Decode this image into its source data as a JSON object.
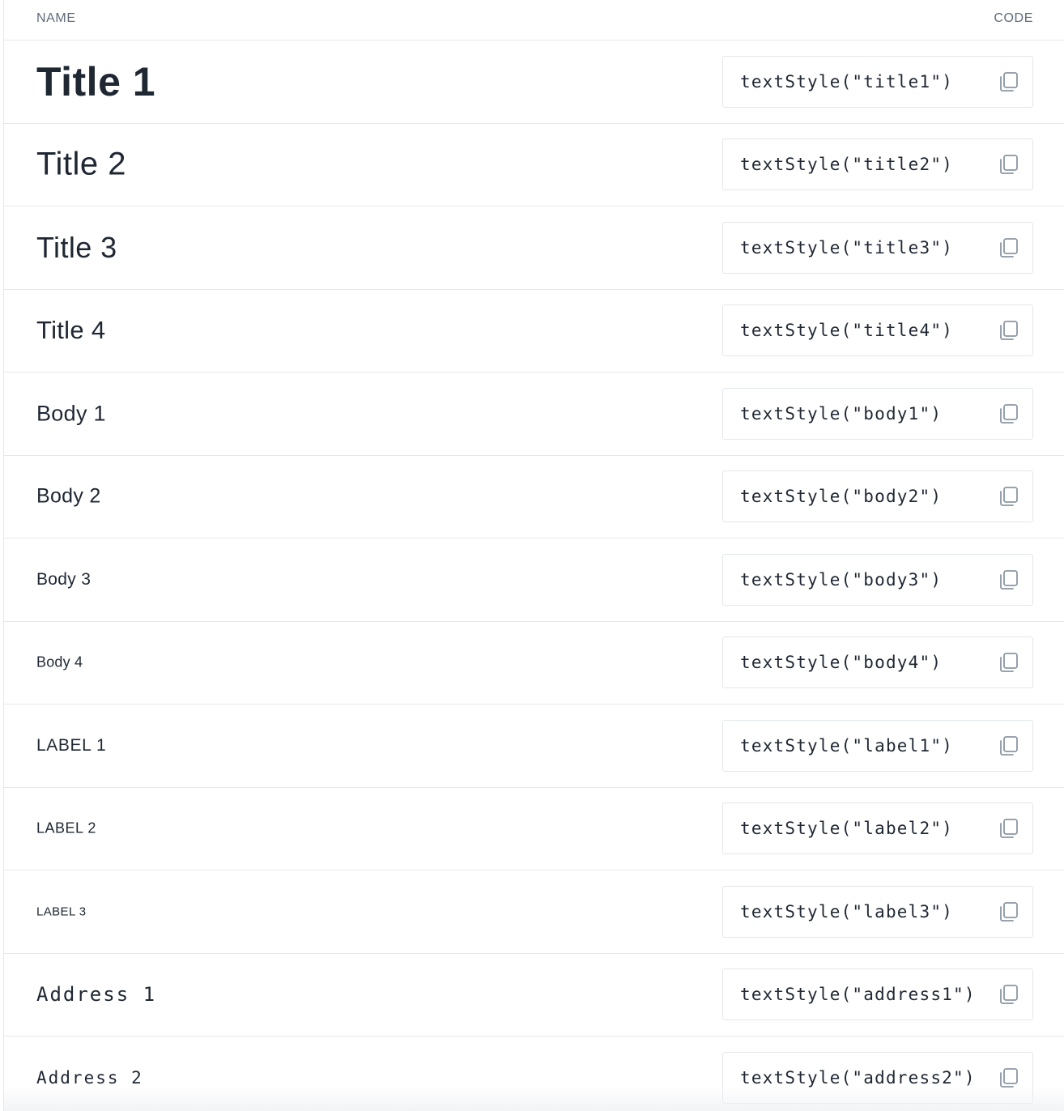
{
  "header": {
    "name_label": "NAME",
    "code_label": "CODE"
  },
  "icons": {
    "copy": "copy-icon"
  },
  "colors": {
    "text": "#1f2733",
    "muted": "#5f6b7a",
    "border": "#e6e8eb",
    "icon": "#8a96a3"
  },
  "rows": [
    {
      "name": "Title 1",
      "code": "textStyle(\"title1\")"
    },
    {
      "name": "Title 2",
      "code": "textStyle(\"title2\")"
    },
    {
      "name": "Title 3",
      "code": "textStyle(\"title3\")"
    },
    {
      "name": "Title 4",
      "code": "textStyle(\"title4\")"
    },
    {
      "name": "Body 1",
      "code": "textStyle(\"body1\")"
    },
    {
      "name": "Body 2",
      "code": "textStyle(\"body2\")"
    },
    {
      "name": "Body 3",
      "code": "textStyle(\"body3\")"
    },
    {
      "name": "Body 4",
      "code": "textStyle(\"body4\")"
    },
    {
      "name": "LABEL 1",
      "code": "textStyle(\"label1\")"
    },
    {
      "name": "LABEL 2",
      "code": "textStyle(\"label2\")"
    },
    {
      "name": "LABEL 3",
      "code": "textStyle(\"label3\")"
    },
    {
      "name": "Address 1",
      "code": "textStyle(\"address1\")"
    },
    {
      "name": "Address 2",
      "code": "textStyle(\"address2\")"
    }
  ]
}
